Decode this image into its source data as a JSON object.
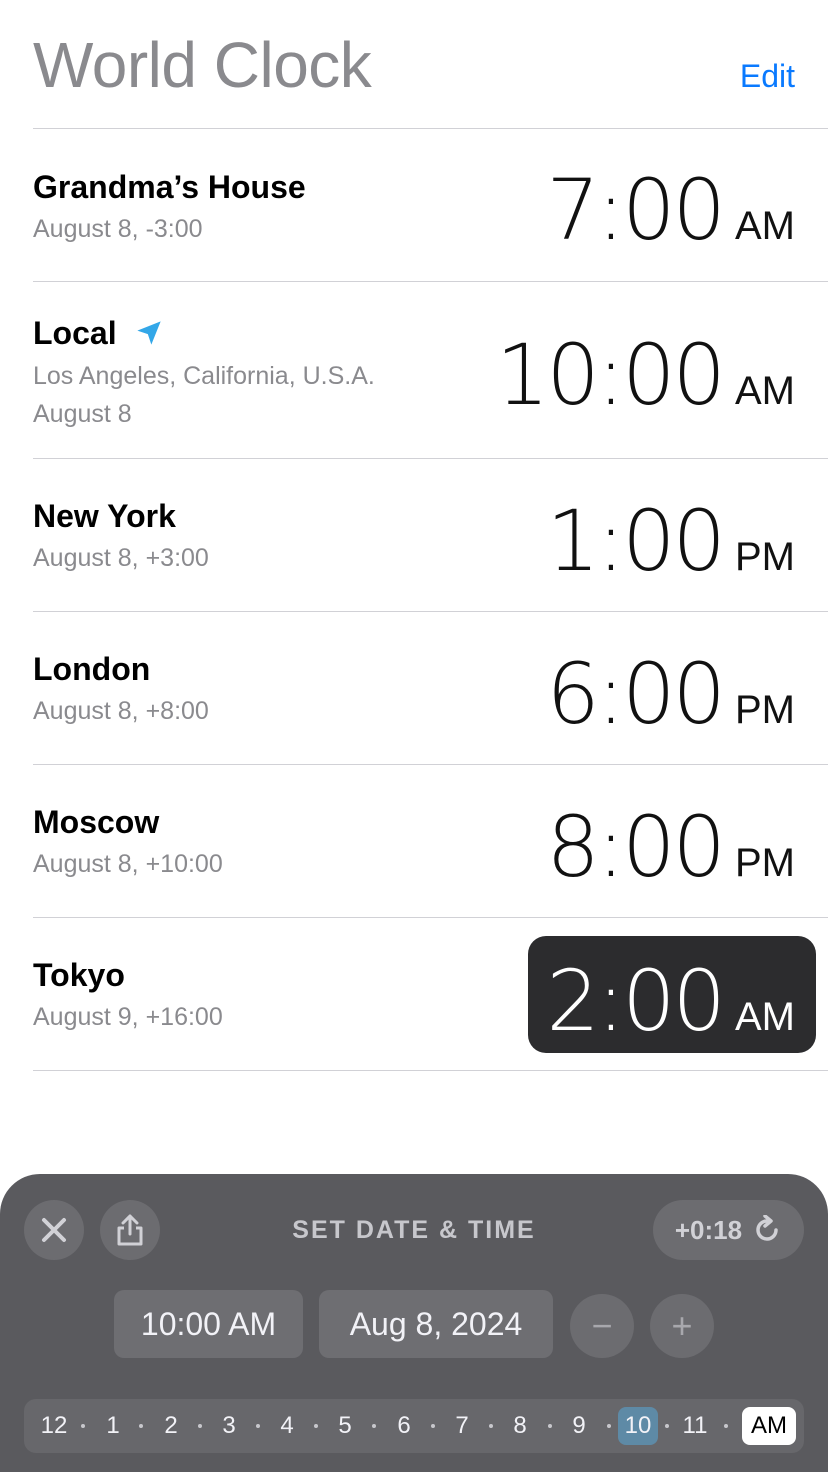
{
  "header": {
    "title": "World Clock",
    "edit_label": "Edit"
  },
  "clocks": [
    {
      "city": "Grandma’s House",
      "sub": "August 8, -3:00",
      "time": "7:00",
      "ampm": "AM"
    },
    {
      "city": "Local",
      "sub1": "Los Angeles, California, U.S.A.",
      "sub2": "August 8",
      "time": "10:00",
      "ampm": "AM"
    },
    {
      "city": "New York",
      "sub": "August 8, +3:00",
      "time": "1:00",
      "ampm": "PM"
    },
    {
      "city": "London",
      "sub": "August 8, +8:00",
      "time": "6:00",
      "ampm": "PM"
    },
    {
      "city": "Moscow",
      "sub": "August 8, +10:00",
      "time": "8:00",
      "ampm": "PM"
    },
    {
      "city": "Tokyo",
      "sub": "August 9, +16:00",
      "time": "2:00",
      "ampm": "AM"
    }
  ],
  "panel": {
    "title": "SET DATE & TIME",
    "offset": "+0:18",
    "time_value": "10:00 AM",
    "date_value": "Aug 8, 2024",
    "minus_label": "−",
    "plus_label": "+",
    "hours": [
      "12",
      "1",
      "2",
      "3",
      "4",
      "5",
      "6",
      "7",
      "8",
      "9",
      "10",
      "11"
    ],
    "selected_hour": "10",
    "ampm": "AM"
  },
  "icons": {
    "close": "close-icon",
    "share": "share-icon",
    "reset": "reset-icon",
    "location": "location-arrow-icon"
  },
  "colors": {
    "accent": "#0a7aff",
    "location": "#33a7e8",
    "selected_hour": "#5e8aa6"
  }
}
